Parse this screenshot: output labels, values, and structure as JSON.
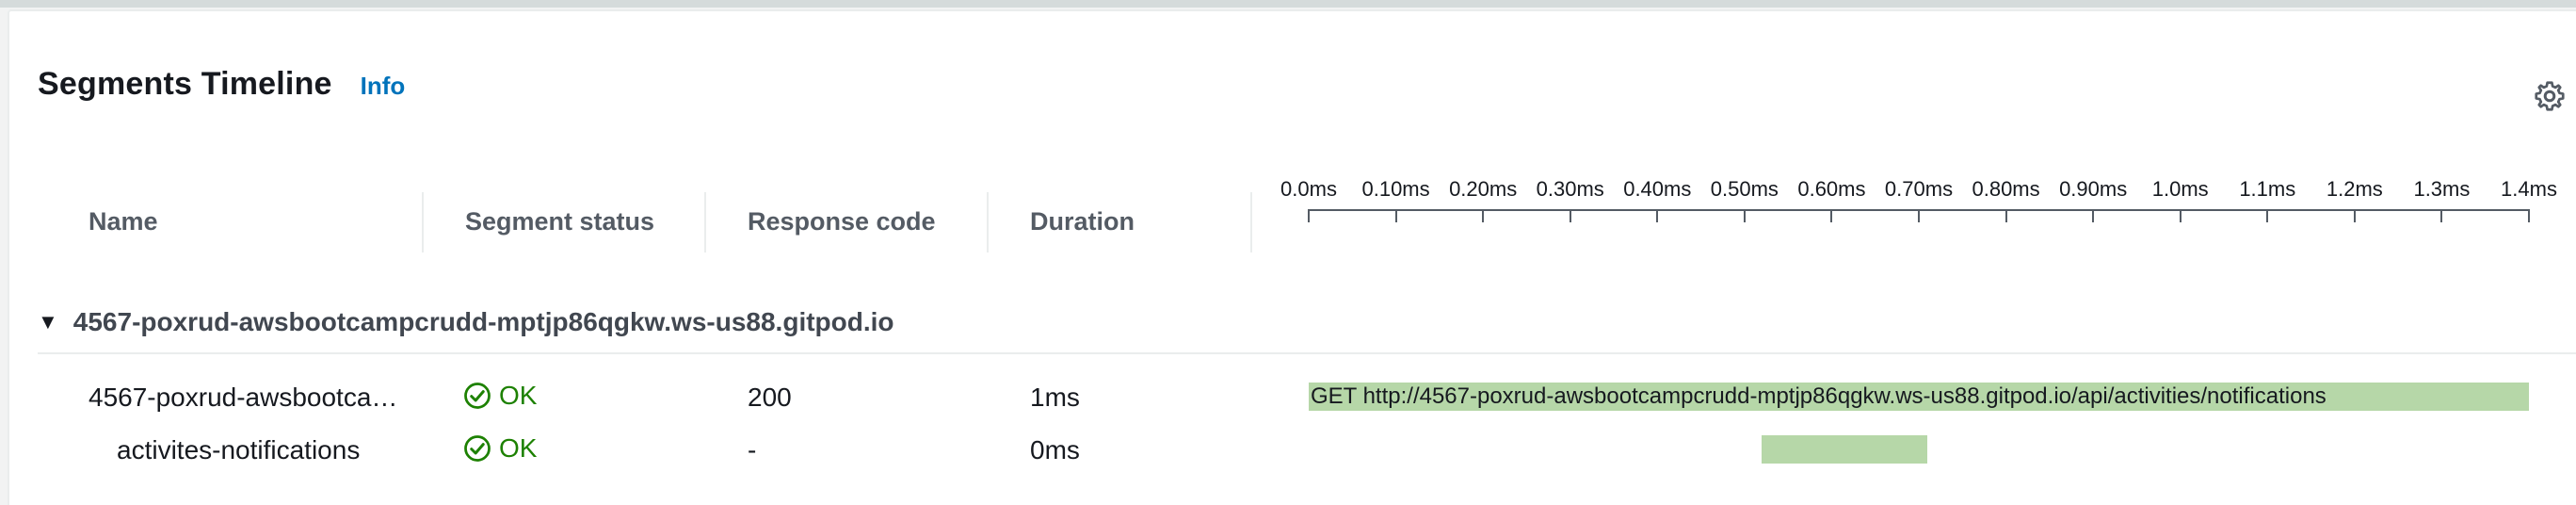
{
  "panel": {
    "title": "Segments Timeline",
    "info_link": "Info",
    "settings_icon": "gear-icon"
  },
  "columns": {
    "name": "Name",
    "segment_status": "Segment status",
    "response_code": "Response code",
    "duration": "Duration"
  },
  "timeline": {
    "ticks": [
      "0.0ms",
      "0.10ms",
      "0.20ms",
      "0.30ms",
      "0.40ms",
      "0.50ms",
      "0.60ms",
      "0.70ms",
      "0.80ms",
      "0.90ms",
      "1.0ms",
      "1.1ms",
      "1.2ms",
      "1.3ms",
      "1.4ms"
    ]
  },
  "group": {
    "name": "4567-poxrud-awsbootcampcrudd-mptjp86qgkw.ws-us88.gitpod.io",
    "expand_icon": "caret-down-icon"
  },
  "rows": [
    {
      "name": "4567-poxrud-awsbootca…",
      "status": "OK",
      "response_code": "200",
      "duration": "1ms",
      "bar_label": "GET http://4567-poxrud-awsbootcampcrudd-mptjp86qgkw.ws-us88.gitpod.io/api/activities/notifications",
      "bar_start_ms": 0.0,
      "bar_end_ms": 1.4
    },
    {
      "name": "activites-notifications",
      "status": "OK",
      "response_code": "-",
      "duration": "0ms",
      "bar_label": "",
      "bar_start_ms": 0.52,
      "bar_end_ms": 0.71
    }
  ],
  "colors": {
    "ok": "#1d8102",
    "link": "#0073bb",
    "bar": "#b6d7a8"
  }
}
